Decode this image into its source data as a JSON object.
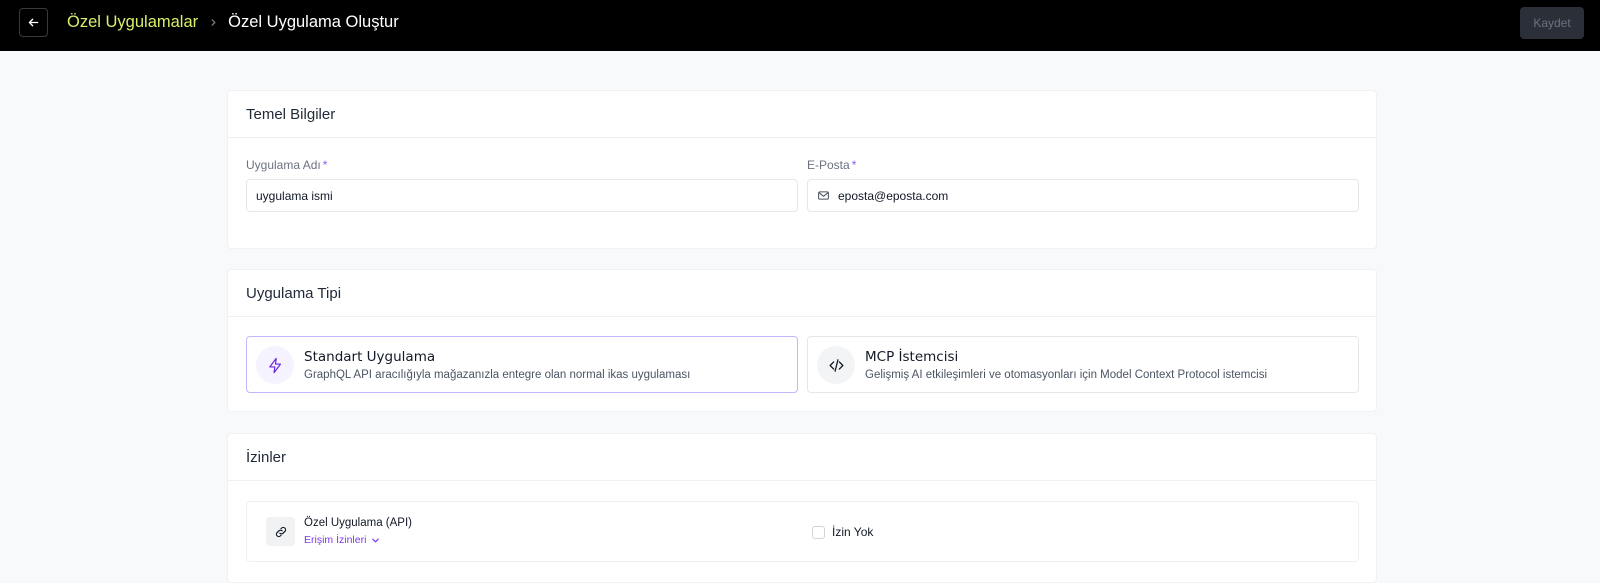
{
  "header": {
    "breadcrumb_parent": "Özel Uygulamalar",
    "breadcrumb_current": "Özel Uygulama Oluştur",
    "save_label": "Kaydet"
  },
  "basic_info": {
    "title": "Temel Bilgiler",
    "app_name": {
      "label": "Uygulama Adı",
      "required_mark": "*",
      "value": "uygulama ismi"
    },
    "email": {
      "label": "E-Posta",
      "required_mark": "*",
      "value": "eposta@eposta.com"
    }
  },
  "app_type": {
    "title": "Uygulama Tipi",
    "options": [
      {
        "title": "Standart Uygulama",
        "description": "GraphQL API aracılığıyla mağazanızla entegre olan normal ikas uygulaması",
        "icon": "lightning-icon",
        "selected": true
      },
      {
        "title": "MCP İstemcisi",
        "description": "Gelişmiş AI etkileşimleri ve otomasyonları için Model Context Protocol istemcisi",
        "icon": "code-icon",
        "selected": false
      }
    ]
  },
  "permissions": {
    "title": "İzinler",
    "item_title": "Özel Uygulama (API)",
    "access_link": "Erişim İzinleri",
    "checkbox_label": "İzin Yok",
    "checkbox_checked": false
  },
  "colors": {
    "accent_yellow": "#d9f06b",
    "accent_purple": "#7c3aed",
    "header_bg": "#000000"
  }
}
